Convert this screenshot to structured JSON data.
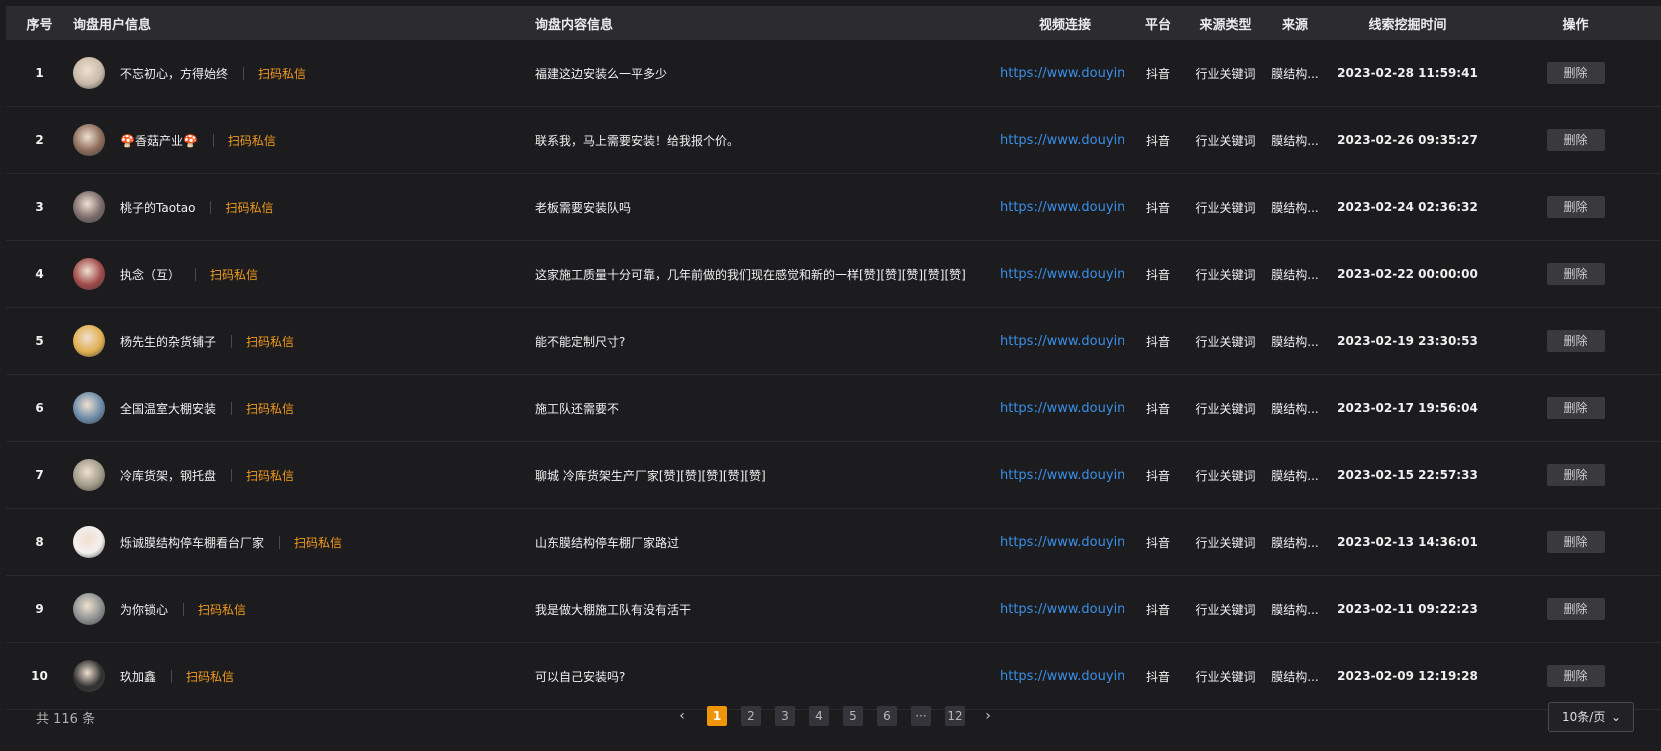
{
  "columns": {
    "index": "序号",
    "user": "询盘用户信息",
    "content": "询盘内容信息",
    "video": "视频连接",
    "platform": "平台",
    "source_type": "来源类型",
    "source": "来源",
    "time": "线索挖掘时间",
    "action": "操作"
  },
  "qr_label": "扫码私信",
  "delete_label": "删除",
  "rows": [
    {
      "index": "1",
      "name": "不忘初心，方得始终",
      "content": "福建这边安装么一平多少",
      "link": "https://www.douyin.com",
      "platform": "抖音",
      "source_type": "行业关键词",
      "source": "膜结构...",
      "time": "2023-02-28 11:59:41",
      "avatar_color": "#c9b9a8"
    },
    {
      "index": "2",
      "name": "🍄香菇产业🍄",
      "content": "联系我，马上需要安装！给我报个价。",
      "link": "https://www.douyin.com",
      "platform": "抖音",
      "source_type": "行业关键词",
      "source": "膜结构...",
      "time": "2023-02-26 09:35:27",
      "avatar_color": "#8a6a58"
    },
    {
      "index": "3",
      "name": "桃子的Taotao",
      "content": "老板需要安装队吗",
      "link": "https://www.douyin.com",
      "platform": "抖音",
      "source_type": "行业关键词",
      "source": "膜结构...",
      "time": "2023-02-24 02:36:32",
      "avatar_color": "#7a6a6a"
    },
    {
      "index": "4",
      "name": "执念（互）",
      "content": "这家施工质量十分可靠，几年前做的我们现在感觉和新的一样[赞][赞][赞][赞][赞]",
      "link": "https://www.douyin.com",
      "platform": "抖音",
      "source_type": "行业关键词",
      "source": "膜结构...",
      "time": "2023-02-22 00:00:00",
      "avatar_color": "#a04848"
    },
    {
      "index": "5",
      "name": "杨先生的杂货铺子",
      "content": "能不能定制尺寸?",
      "link": "https://www.douyin.com",
      "platform": "抖音",
      "source_type": "行业关键词",
      "source": "膜结构...",
      "time": "2023-02-19 23:30:53",
      "avatar_color": "#e0b050"
    },
    {
      "index": "6",
      "name": "全国温室大棚安装",
      "content": "施工队还需要不",
      "link": "https://www.douyin.com",
      "platform": "抖音",
      "source_type": "行业关键词",
      "source": "膜结构...",
      "time": "2023-02-17 19:56:04",
      "avatar_color": "#6a8aa8"
    },
    {
      "index": "7",
      "name": "冷库货架，钢托盘",
      "content": "聊城 冷库货架生产厂家[赞][赞][赞][赞][赞]",
      "link": "https://www.douyin.com",
      "platform": "抖音",
      "source_type": "行业关键词",
      "source": "膜结构...",
      "time": "2023-02-15 22:57:33",
      "avatar_color": "#a09a88"
    },
    {
      "index": "8",
      "name": "烁诚膜结构停车棚看台厂家",
      "content": "山东膜结构停车棚厂家路过",
      "link": "https://www.douyin.com",
      "platform": "抖音",
      "source_type": "行业关键词",
      "source": "膜结构...",
      "time": "2023-02-13 14:36:01",
      "avatar_color": "#f4f0f0"
    },
    {
      "index": "9",
      "name": "为你锁心",
      "content": "我是做大棚施工队有没有活干",
      "link": "https://www.douyin.com",
      "platform": "抖音",
      "source_type": "行业关键词",
      "source": "膜结构...",
      "time": "2023-02-11 09:22:23",
      "avatar_color": "#8a9090"
    },
    {
      "index": "10",
      "name": "玖加鑫",
      "content": "可以自己安装吗?",
      "link": "https://www.douyin.com",
      "platform": "抖音",
      "source_type": "行业关键词",
      "source": "膜结构...",
      "time": "2023-02-09 12:19:28",
      "avatar_color": "#303030"
    }
  ],
  "pagination": {
    "total_text": "共 116 条",
    "prev": "‹",
    "next": "›",
    "pages": [
      "1",
      "2",
      "3",
      "4",
      "5",
      "6",
      "···",
      "12"
    ],
    "current": "1",
    "page_size": "10条/页",
    "chevron": "⌄"
  }
}
